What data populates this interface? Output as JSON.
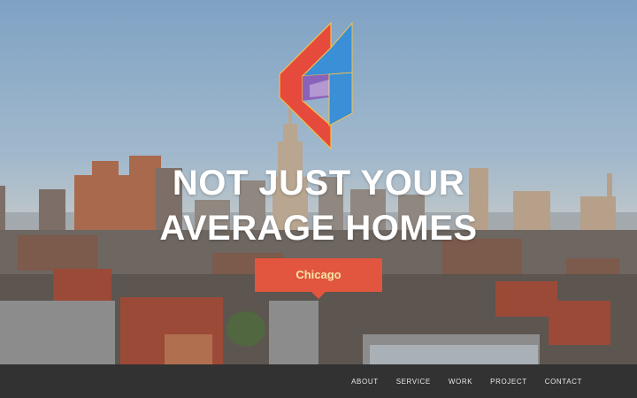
{
  "hero": {
    "headline_line1": "NOT JUST YOUR",
    "headline_line2": "AVERAGE HOMES",
    "city_button_label": "Chicago"
  },
  "nav": {
    "items": [
      {
        "label": "ABOUT"
      },
      {
        "label": "SERVICE"
      },
      {
        "label": "WORK"
      },
      {
        "label": "PROJECT"
      },
      {
        "label": "CONTACT"
      }
    ]
  },
  "colors": {
    "accent": "#e2553e",
    "accent_text": "#f7e6a6",
    "navbar_bg": "#323232",
    "logo_red": "#e64a3c",
    "logo_blue": "#3a8fd6",
    "logo_purple": "#8a5ab8"
  }
}
